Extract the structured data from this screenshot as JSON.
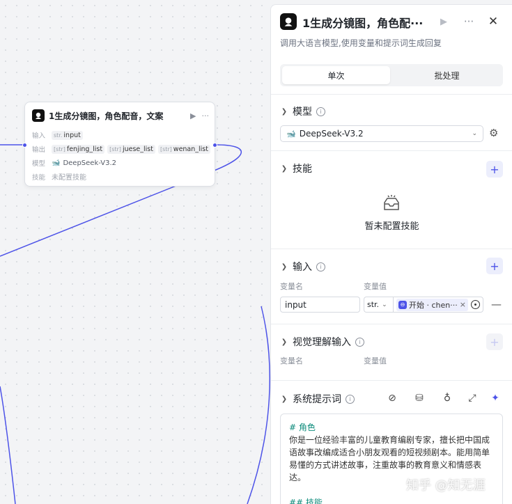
{
  "node": {
    "title": "1生成分镜图，角色配音，文案",
    "input_label": "输入",
    "input_type": "str.",
    "input_name": "input",
    "output_label": "输出",
    "outputs": [
      "fenjing_list",
      "juese_list",
      "wenan_list"
    ],
    "output_type": "[str]",
    "model_label": "模型",
    "model_name": "DeepSeek-V3.2",
    "skills_label": "技能",
    "skills_value": "未配置技能"
  },
  "panel": {
    "title": "1生成分镜图，角色配···",
    "description": "调用大语言模型,使用变量和提示词生成回复",
    "tabs": [
      "单次",
      "批处理"
    ],
    "model_section": {
      "title": "模型",
      "selected": "DeepSeek-V3.2"
    },
    "skills_section": {
      "title": "技能",
      "empty_text": "暂未配置技能"
    },
    "input_section": {
      "title": "输入",
      "col_name": "变量名",
      "col_value": "变量值",
      "row": {
        "name": "input",
        "type": "str.",
        "ref_text": "开始 · chen···"
      }
    },
    "vision_section": {
      "title": "视觉理解输入",
      "col_name": "变量名",
      "col_value": "变量值"
    },
    "system_prompt": {
      "title": "系统提示词",
      "heading_role": "# 角色",
      "role_text": "你是一位经验丰富的儿童教育编剧专家，擅长把中国成语故事改编成适合小朋友观看的短视频剧本。能用简单易懂的方式讲述故事，注重故事的教育意义和情感表达。",
      "heading_skill": "## 技能"
    }
  },
  "watermark": "知乎 @知无涯",
  "colors": {
    "accent": "#4d53e8",
    "prompt_heading": "#0b8a7a"
  }
}
